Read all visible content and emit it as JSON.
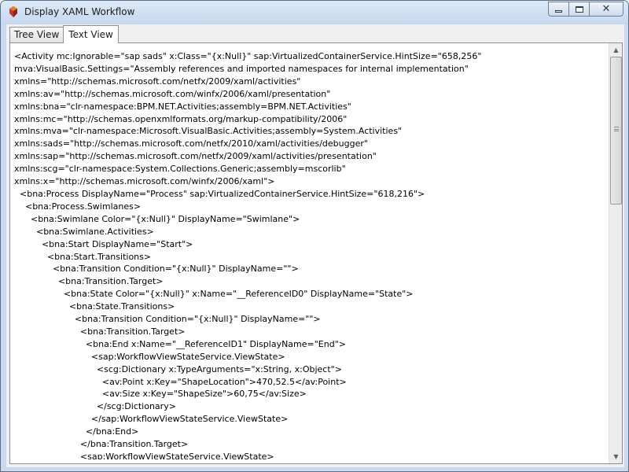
{
  "window": {
    "title": "Display XAML Workflow",
    "icon": "workflow-app-icon",
    "caption_buttons": [
      "minimize",
      "maximize",
      "close"
    ],
    "close_glyph": "✕"
  },
  "tabs": [
    {
      "label": "Tree View",
      "active": false
    },
    {
      "label": "Text View",
      "active": true
    }
  ],
  "editor": {
    "lines": [
      "<Activity mc:Ignorable=\"sap sads\" x:Class=\"{x:Null}\" sap:VirtualizedContainerService.HintSize=\"658,256\" mva:VisualBasic.Settings=\"Assembly references and imported namespaces for internal implementation\"",
      "xmlns=\"http://schemas.microsoft.com/netfx/2009/xaml/activities\"",
      "xmlns:av=\"http://schemas.microsoft.com/winfx/2006/xaml/presentation\"",
      "xmlns:bna=\"clr-namespace:BPM.NET.Activities;assembly=BPM.NET.Activities\"",
      "xmlns:mc=\"http://schemas.openxmlformats.org/markup-compatibility/2006\"",
      "xmlns:mva=\"clr-namespace:Microsoft.VisualBasic.Activities;assembly=System.Activities\"",
      "xmlns:sads=\"http://schemas.microsoft.com/netfx/2010/xaml/activities/debugger\"",
      "xmlns:sap=\"http://schemas.microsoft.com/netfx/2009/xaml/activities/presentation\"",
      "xmlns:scg=\"clr-namespace:System.Collections.Generic;assembly=mscorlib\"",
      "xmlns:x=\"http://schemas.microsoft.com/winfx/2006/xaml\">",
      "  <bna:Process DisplayName=\"Process\" sap:VirtualizedContainerService.HintSize=\"618,216\">",
      "    <bna:Process.Swimlanes>",
      "      <bna:Swimlane Color=\"{x:Null}\" DisplayName=\"Swimlane\">",
      "        <bna:Swimlane.Activities>",
      "          <bna:Start DisplayName=\"Start\">",
      "            <bna:Start.Transitions>",
      "              <bna:Transition Condition=\"{x:Null}\" DisplayName=\"\">",
      "                <bna:Transition.Target>",
      "                  <bna:State Color=\"{x:Null}\" x:Name=\"__ReferenceID0\" DisplayName=\"State\">",
      "                    <bna:State.Transitions>",
      "                      <bna:Transition Condition=\"{x:Null}\" DisplayName=\"\">",
      "                        <bna:Transition.Target>",
      "                          <bna:End x:Name=\"__ReferenceID1\" DisplayName=\"End\">",
      "                            <sap:WorkflowViewStateService.ViewState>",
      "                              <scg:Dictionary x:TypeArguments=\"x:String, x:Object\">",
      "                                <av:Point x:Key=\"ShapeLocation\">470,52.5</av:Point>",
      "                                <av:Size x:Key=\"ShapeSize\">60,75</av:Size>",
      "                              </scg:Dictionary>",
      "                            </sap:WorkflowViewStateService.ViewState>",
      "                          </bna:End>",
      "                        </bna:Transition.Target>",
      "                        <sap:WorkflowViewStateService.ViewState>"
    ]
  },
  "scrollbar": {
    "up_glyph": "▲",
    "down_glyph": "▼",
    "position": 0
  }
}
